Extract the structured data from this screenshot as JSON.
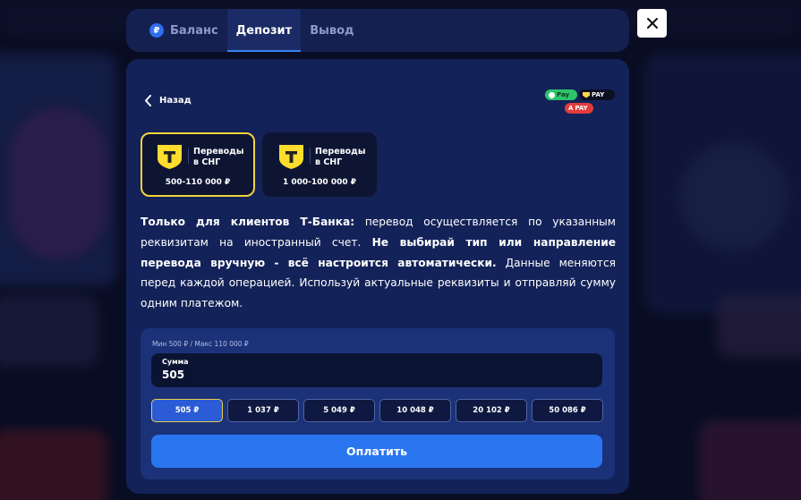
{
  "tabs": [
    {
      "label": "Баланс",
      "icon": "ruble-coin-icon"
    },
    {
      "label": "Депозит"
    },
    {
      "label": "Вывод"
    }
  ],
  "active_tab_index": 1,
  "back_label": "Назад",
  "pay_badges": {
    "green": "Pay",
    "black": "PAY",
    "red": "PAY"
  },
  "methods": [
    {
      "label": "Переводы в СНГ",
      "range": "500-110 000 ₽",
      "selected": true
    },
    {
      "label": "Переводы в СНГ",
      "range": "1 000-100 000 ₽",
      "selected": false
    }
  ],
  "description": {
    "p1_bold": "Только для клиентов Т-Банка:",
    "p1": " перевод осуществляется по указанным реквизитам на иностранный счет. ",
    "p2_bold": "Не выбирай тип или направление перевода вручную - всё настроится автоматически.",
    "p3": " Данные меняются перед каждой операцией. Используй актуальные реквизиты и отправляй сумму одним платежом."
  },
  "amount": {
    "limits": "Мин 500 ₽ / Макс 110 000 ₽",
    "label": "Сумма",
    "value": "505"
  },
  "quick_amounts": [
    "505 ₽",
    "1 037 ₽",
    "5 049 ₽",
    "10 048 ₽",
    "20 102 ₽",
    "50 086 ₽"
  ],
  "active_quick_amount_index": 0,
  "pay_button": "Оплатить",
  "colors": {
    "accent_blue": "#2a76f0",
    "selected_border": "#f2d33c",
    "tbank_yellow": "#ffdd2d"
  }
}
